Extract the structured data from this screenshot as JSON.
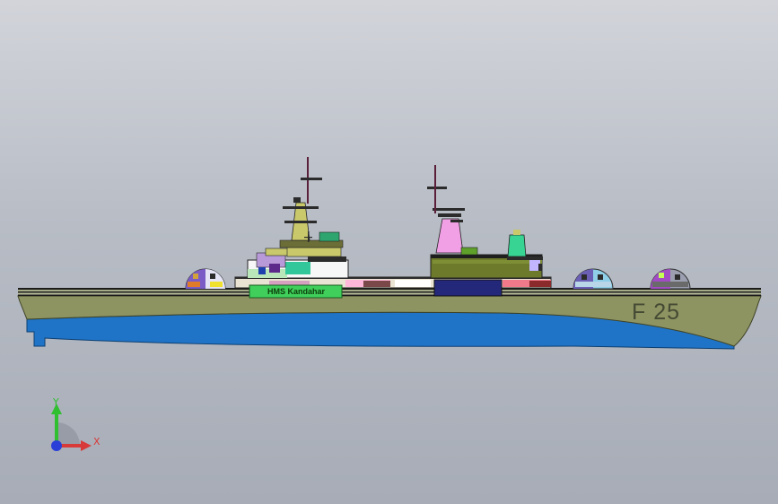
{
  "viewport": {
    "background_top": "#d2d4da",
    "background_bottom": "#a7acb6"
  },
  "model": {
    "hull_number": "F 25",
    "name_board": "HMS Kandahar"
  },
  "triad": {
    "y_label": "Y",
    "x_label": "X",
    "y_color": "#2fbf2f",
    "x_color": "#d83a3a",
    "z_color": "#2a3fd8"
  },
  "colors": {
    "hull": "#8d9361",
    "underwater": "#1f74c8",
    "deck_line": "#1c1c1c",
    "funnel": "#f2a0e6",
    "mast": "#c9c86a",
    "name_board": "#3fcf5a"
  },
  "icons": [
    "coordinate-triad-icon",
    "radome-icon"
  ]
}
